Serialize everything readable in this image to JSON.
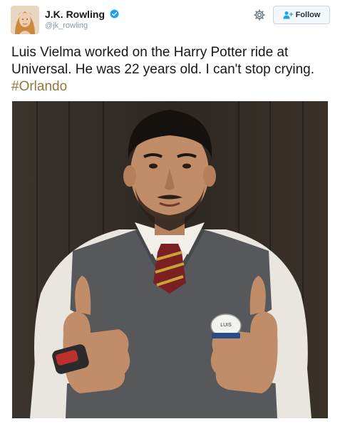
{
  "author": {
    "display_name": "J.K. Rowling",
    "username": "@jk_rowling",
    "verified": true
  },
  "actions": {
    "follow_label": "Follow"
  },
  "tweet": {
    "text": "Luis Vielma worked on the Harry Potter ride at Universal. He was 22 years old. I can't stop crying.",
    "hashtag": "#Orlando"
  },
  "photo": {
    "badge_text": "LUIS"
  },
  "icons": {
    "verified": "verified-badge-icon",
    "settings": "gear-icon",
    "follow": "add-user-icon"
  },
  "colors": {
    "hashtag": "#8c7a3a",
    "verified": "#1da1f2",
    "muted": "#8899a6"
  }
}
